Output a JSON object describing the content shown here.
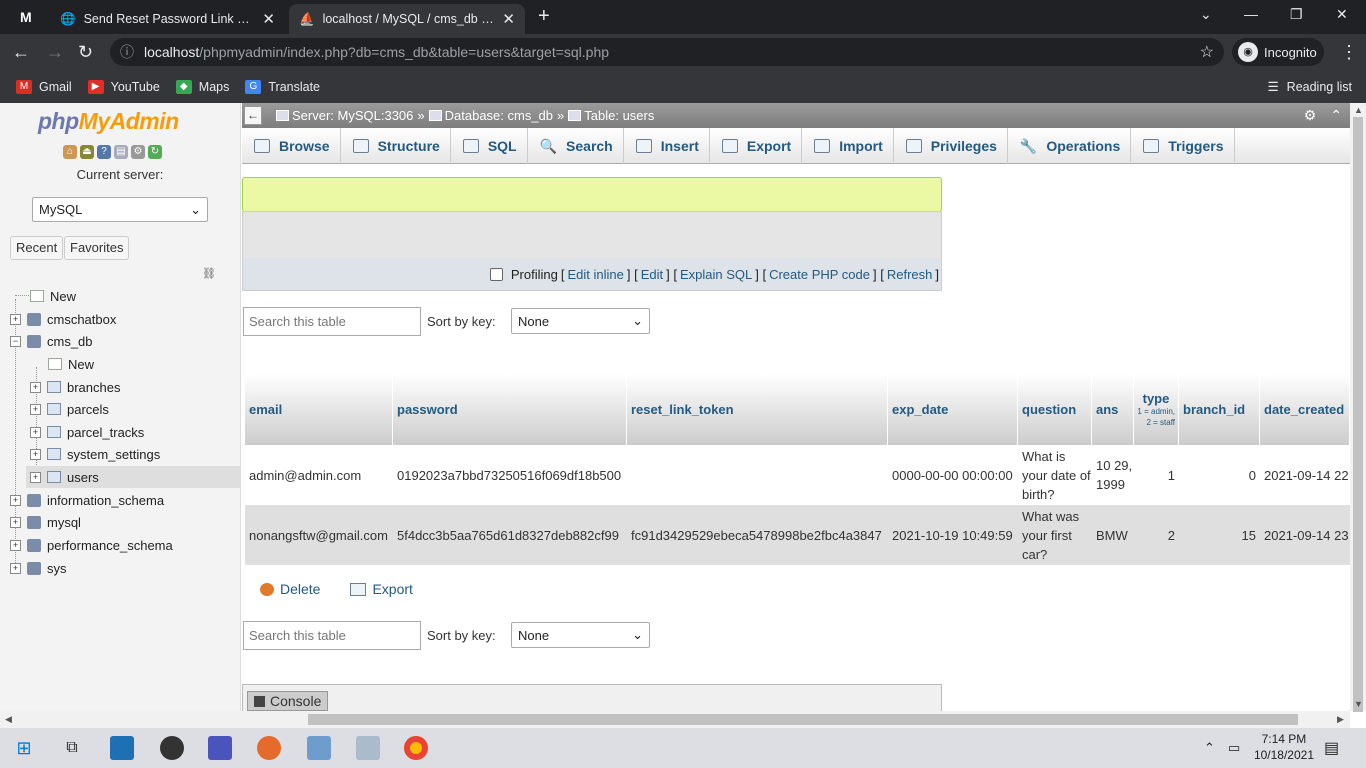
{
  "browser": {
    "tabs": [
      {
        "title": "Send Reset Password Link with E",
        "active": false
      },
      {
        "title": "localhost / MySQL / cms_db / use",
        "active": true
      }
    ],
    "url_host": "localhost",
    "url_path": "/phpmyadmin/index.php?db=cms_db&table=users&target=sql.php",
    "profile": "Incognito",
    "bookmarks": [
      "Gmail",
      "YouTube",
      "Maps",
      "Translate"
    ],
    "reading_list": "Reading list"
  },
  "sidebar": {
    "logo_php": "php",
    "logo_myadmin": "MyAdmin",
    "current_server_label": "Current server:",
    "server_select": "MySQL",
    "recent": "Recent",
    "favorites": "Favorites",
    "tree": {
      "new_top": "New",
      "cmschatbox": "cmschatbox",
      "cms_db": "cms_db",
      "new_db": "New",
      "branches": "branches",
      "parcels": "parcels",
      "parcel_tracks": "parcel_tracks",
      "system_settings": "system_settings",
      "users": "users",
      "information_schema": "information_schema",
      "mysql": "mysql",
      "performance_schema": "performance_schema",
      "sys": "sys"
    }
  },
  "breadcrumb": {
    "server": "Server: MySQL:3306",
    "database": "Database: cms_db",
    "table": "Table: users"
  },
  "tabs": {
    "browse": "Browse",
    "structure": "Structure",
    "sql": "SQL",
    "search": "Search",
    "insert": "Insert",
    "export": "Export",
    "import": "Import",
    "privileges": "Privileges",
    "operations": "Operations",
    "triggers": "Triggers"
  },
  "query_bar": {
    "profiling": "Profiling",
    "edit_inline": "Edit inline",
    "edit": "Edit",
    "explain": "Explain SQL",
    "php_code": "Create PHP code",
    "refresh": "Refresh"
  },
  "filter": {
    "search_placeholder": "Search this table",
    "sort_label": "Sort by key:",
    "sort_value": "None"
  },
  "table": {
    "columns": {
      "email": "email",
      "password": "password",
      "reset_link_token": "reset_link_token",
      "exp_date": "exp_date",
      "question": "question",
      "ans": "ans",
      "type": "type",
      "type_note": "1 = admin, 2 = staff",
      "branch_id": "branch_id",
      "date_created": "date_created"
    },
    "rows": [
      {
        "email": "admin@admin.com",
        "password": "0192023a7bbd73250516f069df18b500",
        "reset_link_token": "",
        "exp_date": "0000-00-00 00:00:00",
        "question": "What is your date of birth?",
        "ans": "10 29, 1999",
        "type": "1",
        "branch_id": "0",
        "date_created": "2021-09-14 22"
      },
      {
        "email": "nonangsftw@gmail.com",
        "password": "5f4dcc3b5aa765d61d8327deb882cf99",
        "reset_link_token": "fc91d3429529ebeca5478998be2fbc4a3847",
        "exp_date": "2021-10-19 10:49:59",
        "question": "What was your first car?",
        "ans": "BMW",
        "type": "2",
        "branch_id": "15",
        "date_created": "2021-09-14 23"
      }
    ]
  },
  "bulk": {
    "delete": "Delete",
    "export": "Export"
  },
  "console": "Console",
  "taskbar": {
    "time": "7:14 PM",
    "date": "10/18/2021"
  }
}
